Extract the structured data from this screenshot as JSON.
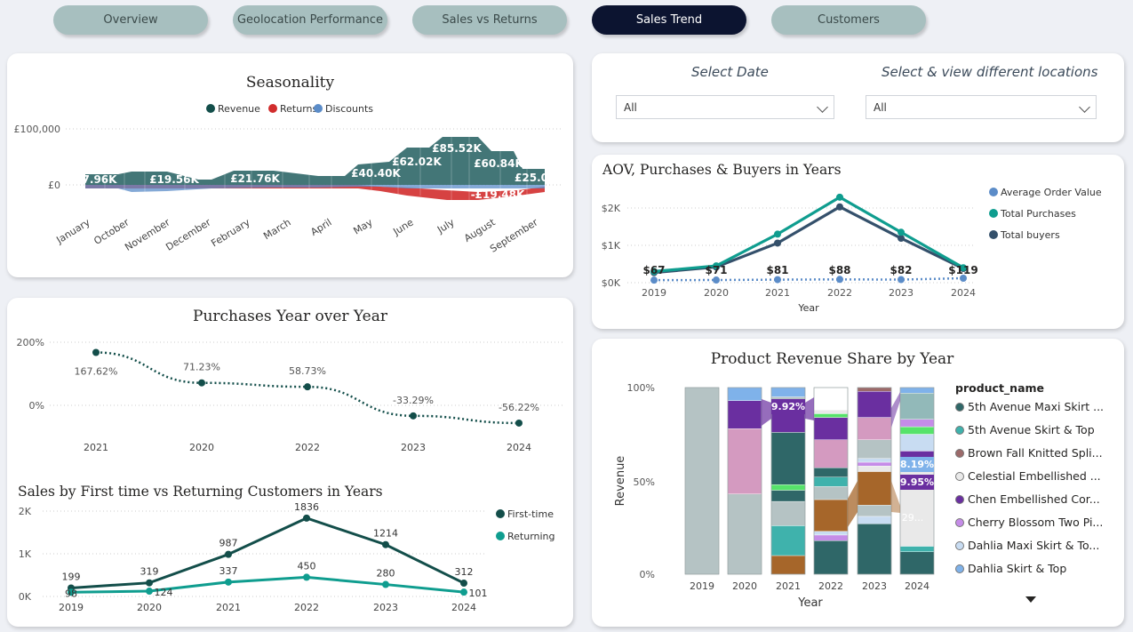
{
  "nav": {
    "tabs": [
      {
        "label": "Overview"
      },
      {
        "label": "Geolocation Performance"
      },
      {
        "label": "Sales vs Returns"
      },
      {
        "label": "Sales Trend"
      },
      {
        "label": "Customers"
      }
    ],
    "active": "Sales Trend"
  },
  "slicers": {
    "date_label": "Select Date",
    "date_value": "All",
    "location_label": "Select & view different locations",
    "location_value": "All"
  },
  "colors": {
    "dark_teal": "#134e4a",
    "teal": "#0f9d8f",
    "navy": "#34506b",
    "red": "#d12d2d",
    "blue": "#5b8cc8",
    "nav_bg": "#a7bfbf",
    "nav_active": "#0c1430"
  },
  "seasonality": {
    "title": "Seasonality",
    "legend": [
      "Revenue",
      "Returns",
      "Discounts"
    ],
    "y_ticks": [
      "£100,000",
      "£0"
    ],
    "months": [
      "January",
      "October",
      "November",
      "December",
      "February",
      "March",
      "April",
      "May",
      "June",
      "July",
      "August",
      "September"
    ],
    "labels": [
      "7.96K",
      "£19.56K",
      "£21.76K",
      "£40.40K",
      "£62.02K",
      "£85.52K",
      "£60.84K",
      "£25.0",
      "-£19.48K"
    ]
  },
  "aov": {
    "title": "AOV, Purchases & Buyers in Years",
    "legend": [
      "Average Order Value",
      "Total Purchases",
      "Total buyers"
    ],
    "y_ticks": [
      "$2K",
      "$1K",
      "$0K"
    ],
    "x_title": "Year",
    "labels": [
      "$67",
      "$71",
      "$81",
      "$88",
      "$82",
      "$119"
    ]
  },
  "yoy": {
    "title": "Purchases Year over Year",
    "y_ticks": [
      "200%",
      "0%"
    ],
    "labels": [
      "167.62%",
      "71.23%",
      "58.73%",
      "-33.29%",
      "-56.22%"
    ]
  },
  "first_time": {
    "title": "Sales by First time vs Returning Customers in Years",
    "y_ticks": [
      "2K",
      "1K",
      "0K"
    ],
    "legend": [
      "First-time",
      "Returning"
    ],
    "first_labels": [
      "199",
      "319",
      "987",
      "1836",
      "1214",
      "312"
    ],
    "returning_labels": [
      "98",
      "124",
      "337",
      "450",
      "280",
      "101"
    ]
  },
  "product": {
    "title": "Product Revenue Share by Year",
    "y_ticks": [
      "100%",
      "50%",
      "0%"
    ],
    "y_title": "Revenue",
    "x_title": "Year",
    "legend_title": "product_name",
    "labels": [
      "9.92%",
      "8.19%",
      "9.95%",
      "29..."
    ],
    "legend": [
      {
        "name": "5th Avenue Maxi Skirt ...",
        "color": "#2f6768"
      },
      {
        "name": "5th Avenue Skirt & Top",
        "color": "#3fb2ac"
      },
      {
        "name": "Brown Fall Knitted Spli...",
        "color": "#9c6a6a"
      },
      {
        "name": "Celestial Embellished ...",
        "color": "#e9e9e9"
      },
      {
        "name": "Chen Embellished Cor...",
        "color": "#6a2fa0"
      },
      {
        "name": "Cherry Blossom Two Pi...",
        "color": "#c58ce8"
      },
      {
        "name": "Dahlia Maxi Skirt & To...",
        "color": "#c8dcf2"
      },
      {
        "name": "Dahlia Skirt & Top",
        "color": "#7fb2ea"
      }
    ]
  },
  "chart_data": [
    {
      "type": "area",
      "title": "Seasonality",
      "categories": [
        "January",
        "October",
        "November",
        "December",
        "February",
        "March",
        "April",
        "May",
        "June",
        "July",
        "August",
        "September"
      ],
      "series": [
        {
          "name": "Revenue",
          "values": [
            7960,
            19560,
            19560,
            5000,
            21760,
            21760,
            15000,
            40400,
            62020,
            85520,
            60840,
            25000
          ]
        },
        {
          "name": "Returns",
          "values": [
            -1000,
            -2000,
            -2000,
            -500,
            -3000,
            -3000,
            -2000,
            -8000,
            -12000,
            -19480,
            -14000,
            -7000
          ]
        },
        {
          "name": "Discounts",
          "values": [
            -2000,
            -4000,
            -4000,
            -1000,
            -4000,
            -4000,
            -3000,
            -4000,
            -5000,
            -6000,
            -5000,
            -3000
          ]
        }
      ],
      "ylim": [
        -40000,
        100000
      ]
    },
    {
      "type": "line",
      "title": "AOV, Purchases & Buyers in Years",
      "x": [
        2019,
        2020,
        2021,
        2022,
        2023,
        2024
      ],
      "series": [
        {
          "name": "Average Order Value",
          "values": [
            67,
            71,
            81,
            88,
            82,
            119
          ]
        },
        {
          "name": "Total Purchases",
          "values": [
            300,
            450,
            1300,
            2290,
            1350,
            400
          ]
        },
        {
          "name": "Total buyers",
          "values": [
            270,
            420,
            1060,
            2030,
            1190,
            380
          ]
        }
      ],
      "xlabel": "Year",
      "ylim": [
        0,
        2200
      ]
    },
    {
      "type": "line",
      "title": "Purchases Year over Year",
      "categories": [
        "2021",
        "2020",
        "2022",
        "2023",
        "2024"
      ],
      "values": [
        167.62,
        71.23,
        58.73,
        -33.29,
        -56.22
      ],
      "ylim": [
        -80,
        200
      ]
    },
    {
      "type": "line",
      "title": "Sales by First time vs Returning Customers in Years",
      "x": [
        2019,
        2020,
        2021,
        2022,
        2023,
        2024
      ],
      "series": [
        {
          "name": "First-time",
          "values": [
            199,
            319,
            987,
            1836,
            1214,
            312
          ]
        },
        {
          "name": "Returning",
          "values": [
            98,
            124,
            337,
            450,
            280,
            101
          ]
        }
      ],
      "ylim": [
        0,
        2000
      ]
    },
    {
      "type": "bar",
      "title": "Product Revenue Share by Year",
      "categories": [
        "2019",
        "2020",
        "2021",
        "2022",
        "2023",
        "2024"
      ],
      "xlabel": "Year",
      "ylabel": "Revenue",
      "ylim": [
        0,
        100
      ]
    }
  ]
}
